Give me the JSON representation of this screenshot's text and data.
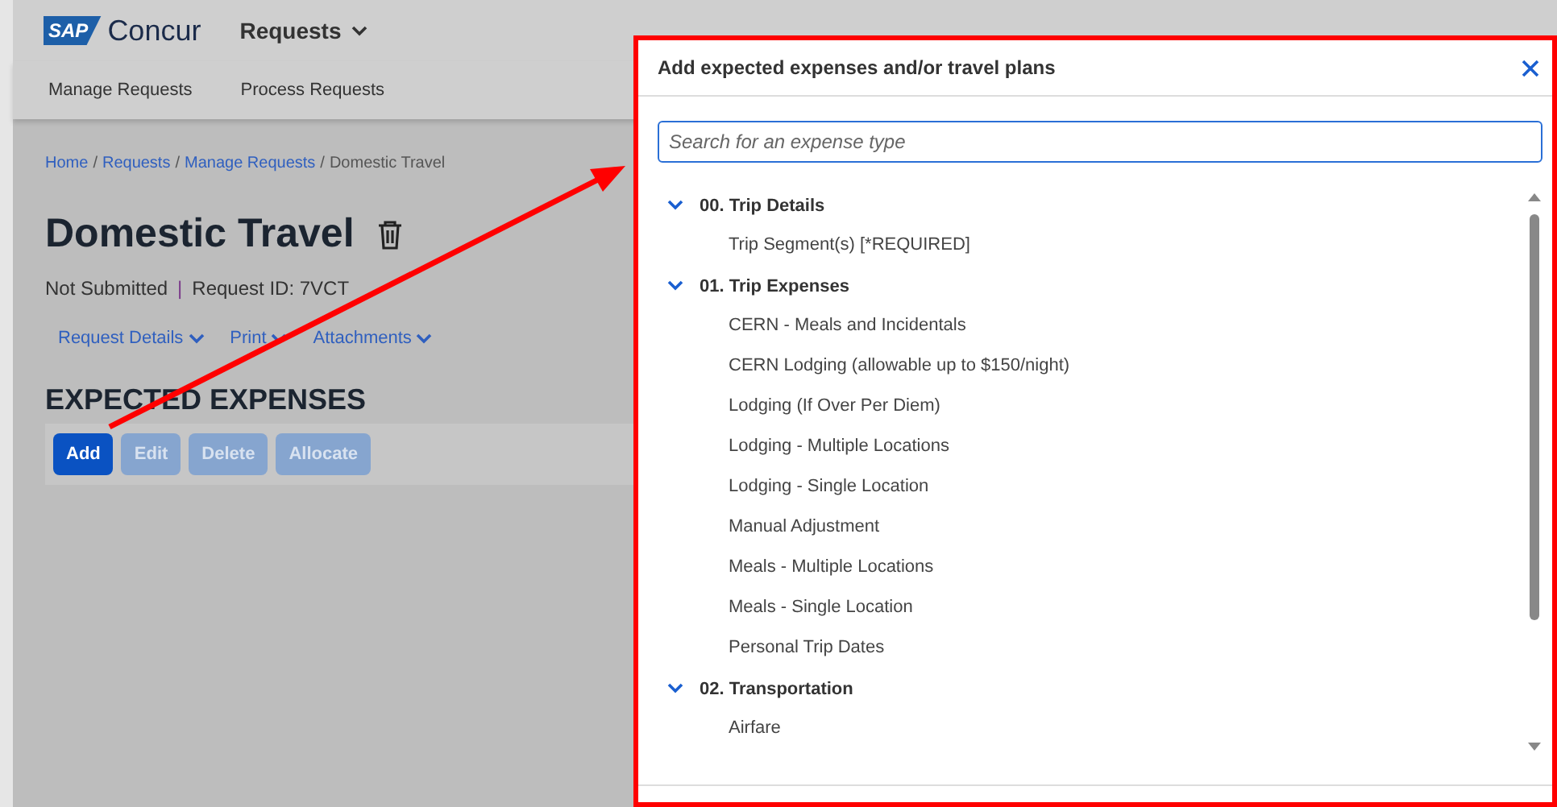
{
  "header": {
    "logo": {
      "mark": "SAP",
      "name": "Concur"
    },
    "menu": "Requests"
  },
  "subnav": [
    {
      "label": "Manage Requests"
    },
    {
      "label": "Process Requests"
    }
  ],
  "breadcrumb": [
    {
      "label": "Home",
      "link": true
    },
    {
      "label": "Requests",
      "link": true
    },
    {
      "label": "Manage Requests",
      "link": true
    },
    {
      "label": "Domestic Travel",
      "link": false
    }
  ],
  "title": "Domestic Travel",
  "breadcrumb_separator": "/",
  "status": "Not Submitted",
  "status_separator": "|",
  "request_id": "Request ID: 7VCT",
  "action_menus": [
    "Request Details",
    "Print",
    "Attachments"
  ],
  "section_title": "EXPECTED EXPENSES",
  "buttons": [
    {
      "label": "Add",
      "disabled": false
    },
    {
      "label": "Edit",
      "disabled": true
    },
    {
      "label": "Delete",
      "disabled": true
    },
    {
      "label": "Allocate",
      "disabled": true
    }
  ],
  "dialog": {
    "title": "Add expected expenses and/or travel plans",
    "search": {
      "placeholder": "Search for an expense type"
    },
    "groups": [
      {
        "label": "00. Trip Details",
        "expanded": true,
        "children": [
          {
            "label": "Trip Segment(s) [*REQUIRED]"
          }
        ]
      },
      {
        "label": "01. Trip Expenses",
        "expanded": true,
        "children": [
          {
            "label": "CERN - Meals and Incidentals"
          },
          {
            "label": "CERN Lodging (allowable up to $150/night)"
          },
          {
            "label": "Lodging (If Over Per Diem)"
          },
          {
            "label": "Lodging - Multiple Locations"
          },
          {
            "label": "Lodging - Single Location"
          },
          {
            "label": "Manual Adjustment"
          },
          {
            "label": "Meals - Multiple Locations"
          },
          {
            "label": "Meals - Single Location"
          },
          {
            "label": "Personal Trip Dates"
          }
        ]
      },
      {
        "label": "02. Transportation",
        "expanded": true,
        "children": [
          {
            "label": "Airfare"
          }
        ]
      }
    ]
  }
}
